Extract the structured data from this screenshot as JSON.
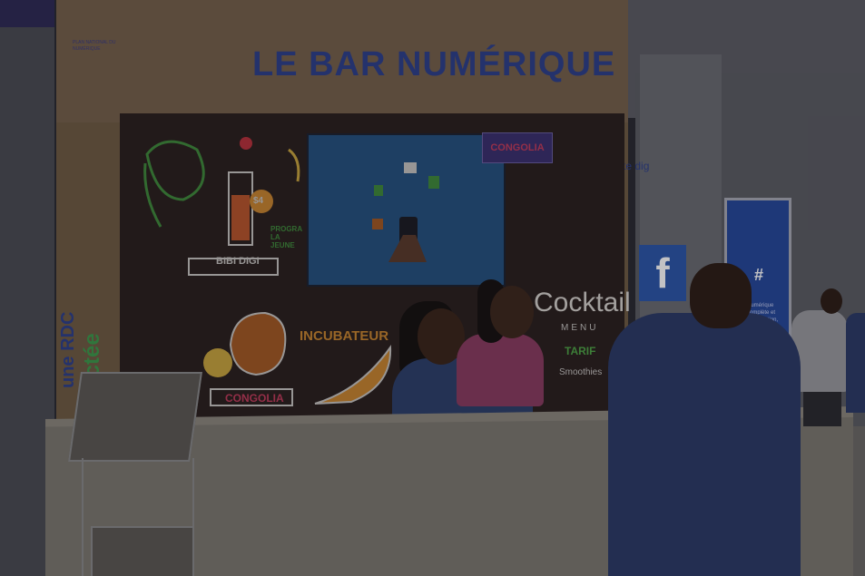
{
  "booth": {
    "title": "LE BAR NUMÉRIQUE",
    "top_left_logo": "PLAN NATIONAL DU NUMÉRIQUE",
    "badge": "CONGOLIA",
    "tagline": "On est juste dig",
    "side_text_1": "une RDC",
    "side_text_2": "nnectée"
  },
  "chalkboard": {
    "bibi_digi": "BIBI DIGI",
    "price": "$4",
    "programme": "PROGRA LA JEUNE",
    "incubateur": "INCUBATEUR",
    "congolia": "CONGOLIA",
    "cocktail": "Cocktail",
    "menu": "MENU",
    "tarif": "TARIF",
    "smoothies": "Smoothies"
  },
  "banner": {
    "hash": "#",
    "text": "Numérique complète et d'intégration, bonne gouvernance, croissance économique et progrès social"
  },
  "colors": {
    "title_blue": "#2d3f8a",
    "chalkboard": "#2a1f1d",
    "facebook_blue": "#2b56a8",
    "screen_blue": "#24507e",
    "green": "#4ea545",
    "orange": "#c8852e"
  }
}
